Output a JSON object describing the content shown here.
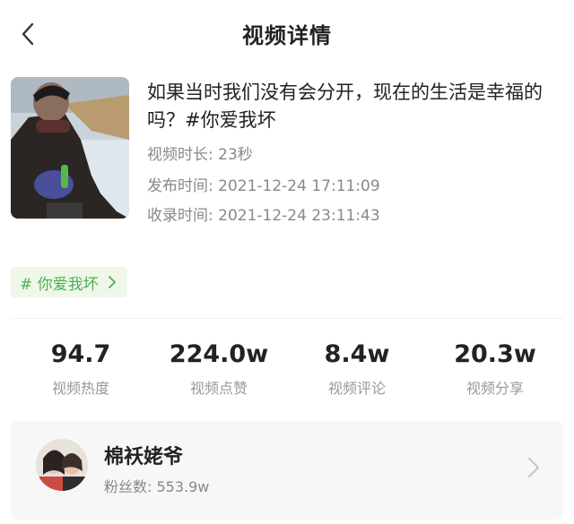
{
  "header": {
    "title": "视频详情",
    "back_icon": "chevron-left-icon"
  },
  "video": {
    "title": "如果当时我们没有会分开，现在的生活是幸福的吗？#你爱我坏",
    "duration_label": "视频时长: ",
    "duration_value": "23秒",
    "publish_label": "发布时间: ",
    "publish_value": "2021-12-24 17:11:09",
    "record_label": "收录时间: ",
    "record_value": "2021-12-24 23:11:43"
  },
  "tag": {
    "label": "# 你爱我坏",
    "icon": "chevron-right-icon",
    "color": "#4caf50",
    "bg": "#eef7ea"
  },
  "stats": [
    {
      "value": "94.7",
      "label": "视频热度"
    },
    {
      "value": "224.0w",
      "label": "视频点赞"
    },
    {
      "value": "8.4w",
      "label": "视频评论"
    },
    {
      "value": "20.3w",
      "label": "视频分享"
    }
  ],
  "author": {
    "name": "棉袄姥爷",
    "fans_label": "粉丝数: ",
    "fans_value": "553.9w",
    "icon": "chevron-right-icon"
  }
}
